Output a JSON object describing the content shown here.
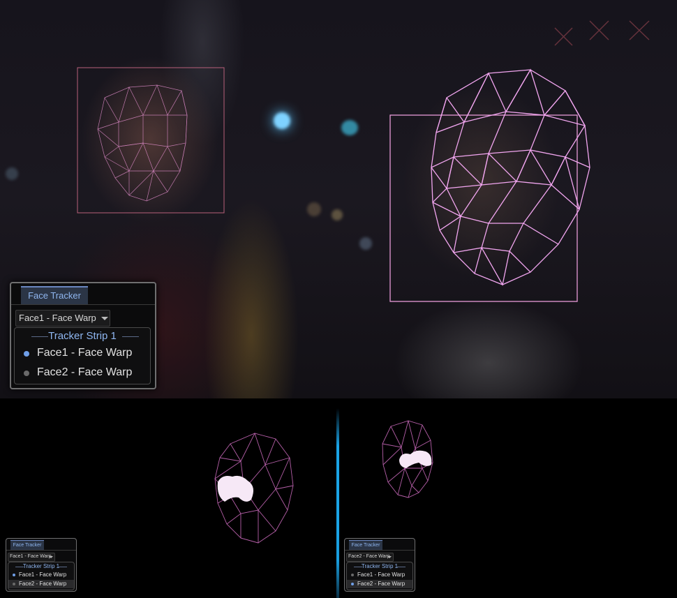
{
  "large_panel": {
    "tab_label": "Face Tracker",
    "dropdown_value": "Face1 - Face Warp",
    "strip_title": "Tracker Strip 1",
    "items": [
      {
        "label": "Face1 - Face Warp",
        "active": true
      },
      {
        "label": "Face2 - Face Warp",
        "active": false
      }
    ]
  },
  "small_panel_left": {
    "tab_label": "Face Tracker",
    "dropdown_value": "Face1 - Face Warp",
    "strip_title": "Tracker Strip 1",
    "items": [
      {
        "label": "Face1 - Face Warp",
        "active": true
      },
      {
        "label": "Face2 - Face Warp",
        "active": false,
        "highlighted": true
      }
    ]
  },
  "small_panel_right": {
    "tab_label": "Face Tracker",
    "dropdown_value": "Face2 - Face Warp",
    "strip_title": "Tracker Strip 1",
    "items": [
      {
        "label": "Face1 - Face Warp",
        "active": false
      },
      {
        "label": "Face2 - Face Warp",
        "active": true,
        "highlighted": true
      }
    ]
  },
  "colors": {
    "mesh_bright": "#f2a6f0",
    "mesh_dim": "#c97fc4",
    "mesh_bottom": "#b55fa8",
    "bbox": "#e79ad8",
    "accent_blue": "#6f9fe8",
    "dot_active": "#6f9fe8",
    "dot_inactive": "#6a6a6a",
    "divider": "#1aa3e6"
  }
}
